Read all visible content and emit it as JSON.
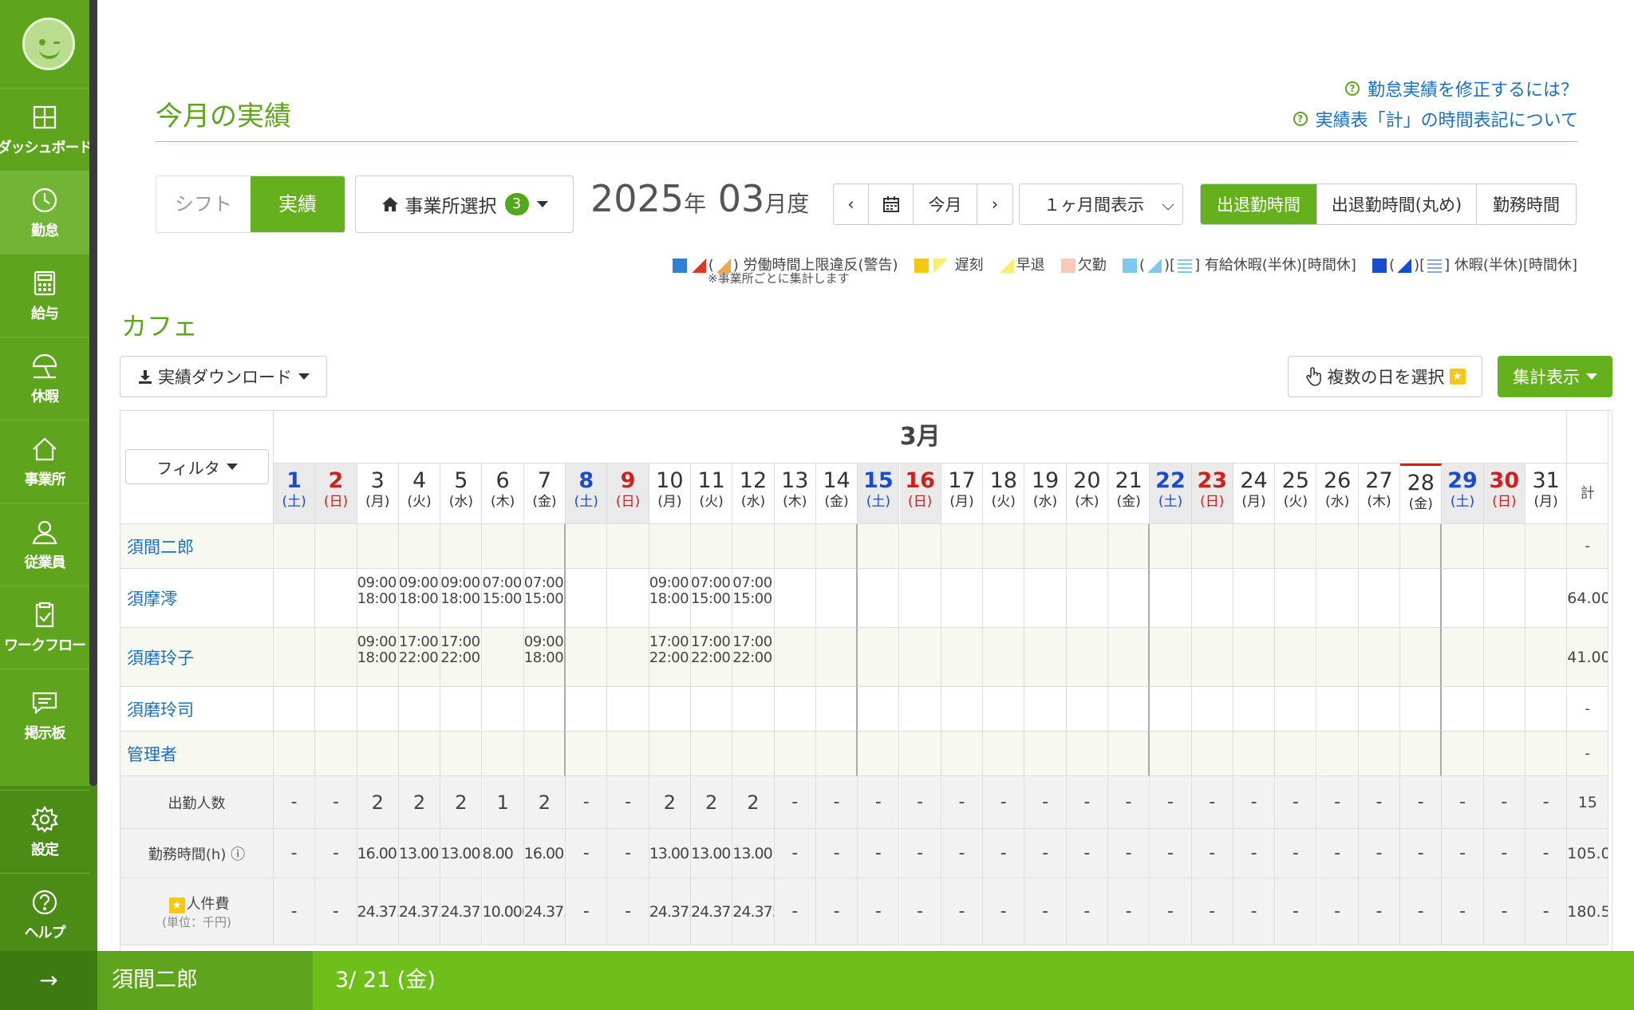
{
  "nav": [
    {
      "label": "ダッシュボード",
      "icon": "dashboard-icon"
    },
    {
      "label": "勤怠",
      "icon": "clock-icon"
    },
    {
      "label": "給与",
      "icon": "calculator-icon"
    },
    {
      "label": "休暇",
      "icon": "beach-umbrella-icon"
    },
    {
      "label": "事業所",
      "icon": "home-icon"
    },
    {
      "label": "従業員",
      "icon": "user-icon"
    },
    {
      "label": "ワークフロー",
      "icon": "clipboard-check-icon"
    },
    {
      "label": "掲示板",
      "icon": "chat-icon"
    },
    {
      "label": "設定",
      "icon": "gear-icon"
    },
    {
      "label": "ヘルプ",
      "icon": "help-icon"
    }
  ],
  "page_title": "今月の実績",
  "help_links": [
    "勤怠実績を修正するには？",
    "実績表「計」の時間表記について"
  ],
  "toggle": {
    "shift": "シフト",
    "actual": "実績"
  },
  "office_select": {
    "label": "事業所選択",
    "count": "3"
  },
  "year": "2025",
  "year_unit": "年",
  "month": "03",
  "month_unit": "月度",
  "nav_buttons": {
    "prev": "‹",
    "today": "今月",
    "next": "›",
    "range": "１ヶ月間表示"
  },
  "view_buttons": [
    "出退勤時間",
    "出退勤時間(丸め)",
    "勤務時間"
  ],
  "legend": {
    "violation": "労働時間上限違反(警告)",
    "late": "遅刻",
    "early": "早退",
    "absent": "欠勤",
    "paid": "有給休暇(半休)[時間休]",
    "holiday": "休暇(半休)[時間休]",
    "note": "※事業所ごとに集計します"
  },
  "section_title": "カフェ",
  "download_label": "実績ダウンロード",
  "multi_select_label": "複数の日を選択",
  "summary_label": "集計表示",
  "filter_label": "フィルタ",
  "month_header": "3月",
  "total_header": "計",
  "days": [
    {
      "d": "1",
      "w": "(土)"
    },
    {
      "d": "2",
      "w": "(日)"
    },
    {
      "d": "3",
      "w": "(月)"
    },
    {
      "d": "4",
      "w": "(火)"
    },
    {
      "d": "5",
      "w": "(水)"
    },
    {
      "d": "6",
      "w": "(木)"
    },
    {
      "d": "7",
      "w": "(金)"
    },
    {
      "d": "8",
      "w": "(土)"
    },
    {
      "d": "9",
      "w": "(日)"
    },
    {
      "d": "10",
      "w": "(月)"
    },
    {
      "d": "11",
      "w": "(火)"
    },
    {
      "d": "12",
      "w": "(水)"
    },
    {
      "d": "13",
      "w": "(木)"
    },
    {
      "d": "14",
      "w": "(金)"
    },
    {
      "d": "15",
      "w": "(土)"
    },
    {
      "d": "16",
      "w": "(日)"
    },
    {
      "d": "17",
      "w": "(月)"
    },
    {
      "d": "18",
      "w": "(火)"
    },
    {
      "d": "19",
      "w": "(水)"
    },
    {
      "d": "20",
      "w": "(木)"
    },
    {
      "d": "21",
      "w": "(金)"
    },
    {
      "d": "22",
      "w": "(土)"
    },
    {
      "d": "23",
      "w": "(日)"
    },
    {
      "d": "24",
      "w": "(月)"
    },
    {
      "d": "25",
      "w": "(火)"
    },
    {
      "d": "26",
      "w": "(水)"
    },
    {
      "d": "27",
      "w": "(木)"
    },
    {
      "d": "28",
      "w": "(金)"
    },
    {
      "d": "29",
      "w": "(土)"
    },
    {
      "d": "30",
      "w": "(日)"
    },
    {
      "d": "31",
      "w": "(月)"
    }
  ],
  "day_colors": {
    "sat": "#1a4ccf",
    "sun": "#d0201d"
  },
  "employees": [
    {
      "name": "須間二郎",
      "shifts": {},
      "total": "-"
    },
    {
      "name": "須摩澪",
      "shifts": {
        "3": [
          "09:00",
          "18:00"
        ],
        "4": [
          "09:00",
          "18:00"
        ],
        "5": [
          "09:00",
          "18:00"
        ],
        "6": [
          "07:00",
          "15:00"
        ],
        "7": [
          "07:00",
          "15:00"
        ],
        "10": [
          "09:00",
          "18:00"
        ],
        "11": [
          "07:00",
          "15:00"
        ],
        "12": [
          "07:00",
          "15:00"
        ]
      },
      "total": "64.00"
    },
    {
      "name": "須磨玲子",
      "shifts": {
        "3": [
          "09:00",
          "18:00"
        ],
        "4": [
          "17:00",
          "22:00"
        ],
        "5": [
          "17:00",
          "22:00"
        ],
        "7": [
          "09:00",
          "18:00"
        ],
        "10": [
          "17:00",
          "22:00"
        ],
        "11": [
          "17:00",
          "22:00"
        ],
        "12": [
          "17:00",
          "22:00"
        ]
      },
      "total": "41.00"
    },
    {
      "name": "須磨玲司",
      "shifts": {},
      "total": "-"
    },
    {
      "name": "管理者",
      "shifts": {},
      "total": "-"
    }
  ],
  "summary_rows": [
    {
      "label": "出勤人数",
      "sub": "",
      "values": {
        "3": "2",
        "4": "2",
        "5": "2",
        "6": "1",
        "7": "2",
        "10": "2",
        "11": "2",
        "12": "2"
      },
      "total": "15"
    },
    {
      "label": "勤務時間(h)",
      "sub": "",
      "values": {
        "3": "16.00",
        "4": "13.00",
        "5": "13.00",
        "6": "8.00",
        "7": "16.00",
        "10": "13.00",
        "11": "13.00",
        "12": "13.00"
      },
      "total": "105.00"
    },
    {
      "label": "人件費",
      "sub": "(単位：千円)",
      "values": {
        "3": "24.375",
        "4": "24.375",
        "5": "24.375",
        "6": "10.000",
        "7": "24.375",
        "10": "24.375",
        "11": "24.375",
        "12": "24.375"
      },
      "total": "180.5"
    }
  ],
  "empty_value": "-",
  "footer": {
    "name": "須間二郎",
    "date": "3/ 21 (金)"
  },
  "expand_arrow": "→",
  "colors": {
    "brand_green": "#5ea51d",
    "accent_green": "#64b11d",
    "link_blue": "#1a6fc0"
  }
}
